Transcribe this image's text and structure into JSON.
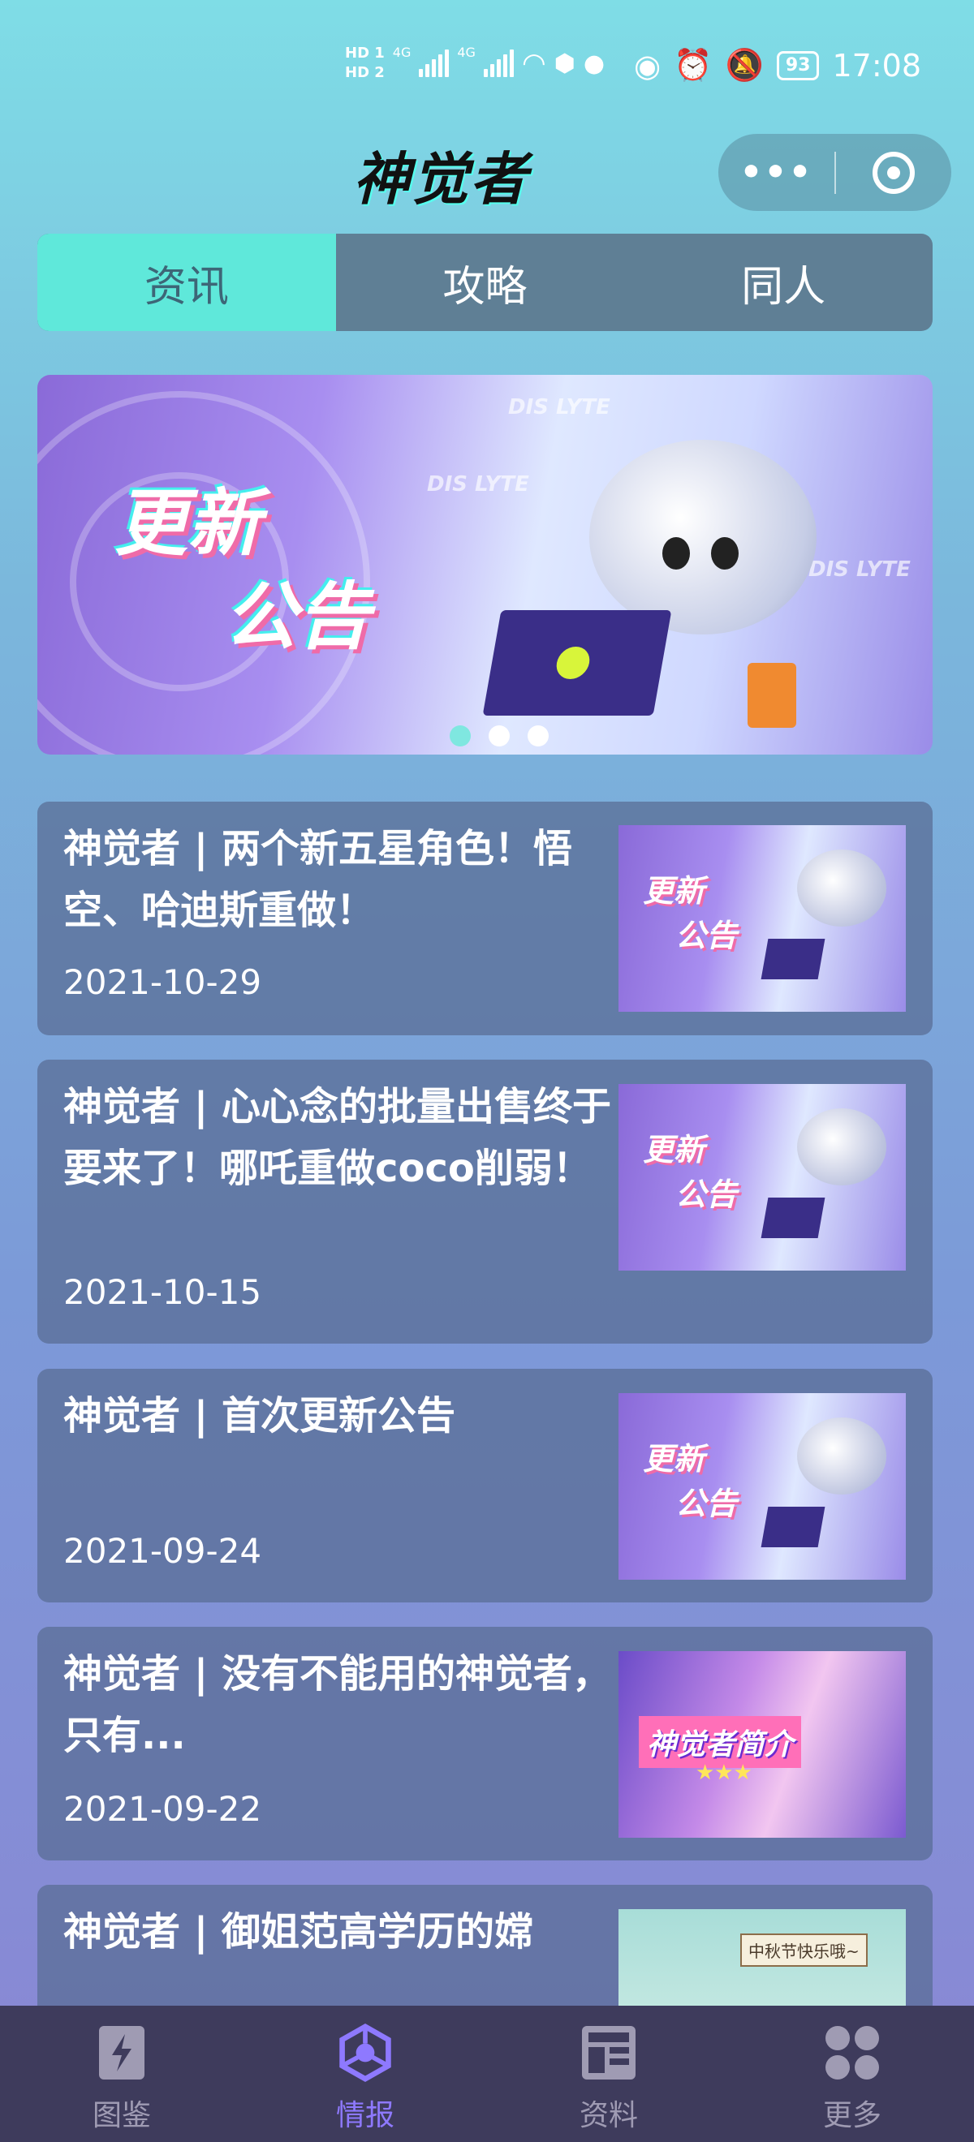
{
  "status_bar": {
    "hd1": "HD 1",
    "hd2": "HD 2",
    "net1": "4G",
    "net2": "4G",
    "battery": "93",
    "time": "17:08"
  },
  "header": {
    "logo": "神觉者",
    "capsule_more": "•••"
  },
  "tabs": [
    {
      "label": "资讯",
      "active": true
    },
    {
      "label": "攻略",
      "active": false
    },
    {
      "label": "同人",
      "active": false
    }
  ],
  "banner": {
    "title_line1": "更新",
    "title_line2": "公告",
    "watermark": "DIS LYTE",
    "pager_total": 3,
    "pager_active": 1
  },
  "news": [
    {
      "title": "神觉者 | 两个新五星角色！悟空、哈迪斯重做！",
      "date": "2021-10-29",
      "thumb_text1": "更新",
      "thumb_text2": "公告"
    },
    {
      "title": "神觉者 | 心心念的批量出售终于要来了！哪吒重做coco削弱！",
      "date": "2021-10-15",
      "thumb_text1": "更新",
      "thumb_text2": "公告"
    },
    {
      "title": "神觉者 | 首次更新公告",
      "date": "2021-09-24",
      "thumb_text1": "更新",
      "thumb_text2": "公告"
    },
    {
      "title": "神觉者 | 没有不能用的神觉者，只有...",
      "date": "2021-09-22",
      "thumb_label": "神觉者简介",
      "thumb_stars": "★★★"
    },
    {
      "title": "神觉者 | 御姐范高学历的嫦",
      "date": "",
      "thumb_sign": "中秋节快乐哦~"
    }
  ],
  "bottom_nav": [
    {
      "label": "图鉴",
      "icon": "book-lightning-icon",
      "active": false
    },
    {
      "label": "情报",
      "icon": "hexagon-network-icon",
      "active": true
    },
    {
      "label": "资料",
      "icon": "grid-document-icon",
      "active": false
    },
    {
      "label": "更多",
      "icon": "four-dots-icon",
      "active": false
    }
  ],
  "colors": {
    "tab_active_bg": "#5fe8da",
    "nav_active": "#8e79ff",
    "nav_bg": "#3e3b5c"
  }
}
